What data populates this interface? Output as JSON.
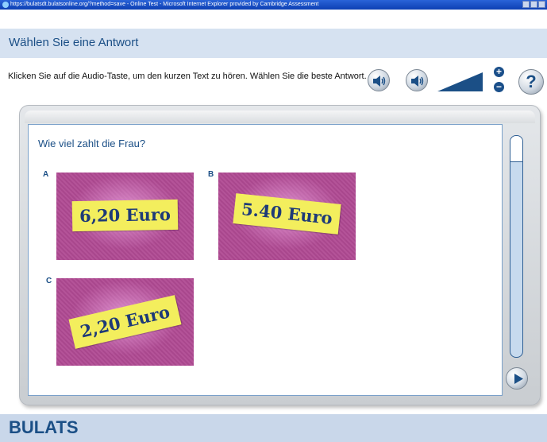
{
  "window": {
    "title": "https://bulatsdt.bulatsonline.org/?method=save - Online Test - Microsoft Internet Explorer provided by Cambridge Assessment"
  },
  "header": {
    "title": "Wählen Sie eine Antwort"
  },
  "instruction": "Klicken Sie auf die Audio-Taste, um den kurzen Text zu hören. Wählen Sie die beste Antwort.",
  "controls": {
    "zoom_in": "+",
    "zoom_out": "−",
    "help": "?"
  },
  "question": {
    "text": "Wie viel zahlt die Frau?",
    "options": [
      {
        "letter": "A",
        "note": "6,20 Euro"
      },
      {
        "letter": "B",
        "note": "5.40 Euro"
      },
      {
        "letter": "C",
        "note": "2,20 Euro"
      }
    ]
  },
  "footer": {
    "brand": "BULATS"
  },
  "colors": {
    "brand_blue": "#1b4f86",
    "band": "#d6e2f1",
    "card_purple": "#b04a93",
    "note_yellow": "#f3ee5d"
  }
}
